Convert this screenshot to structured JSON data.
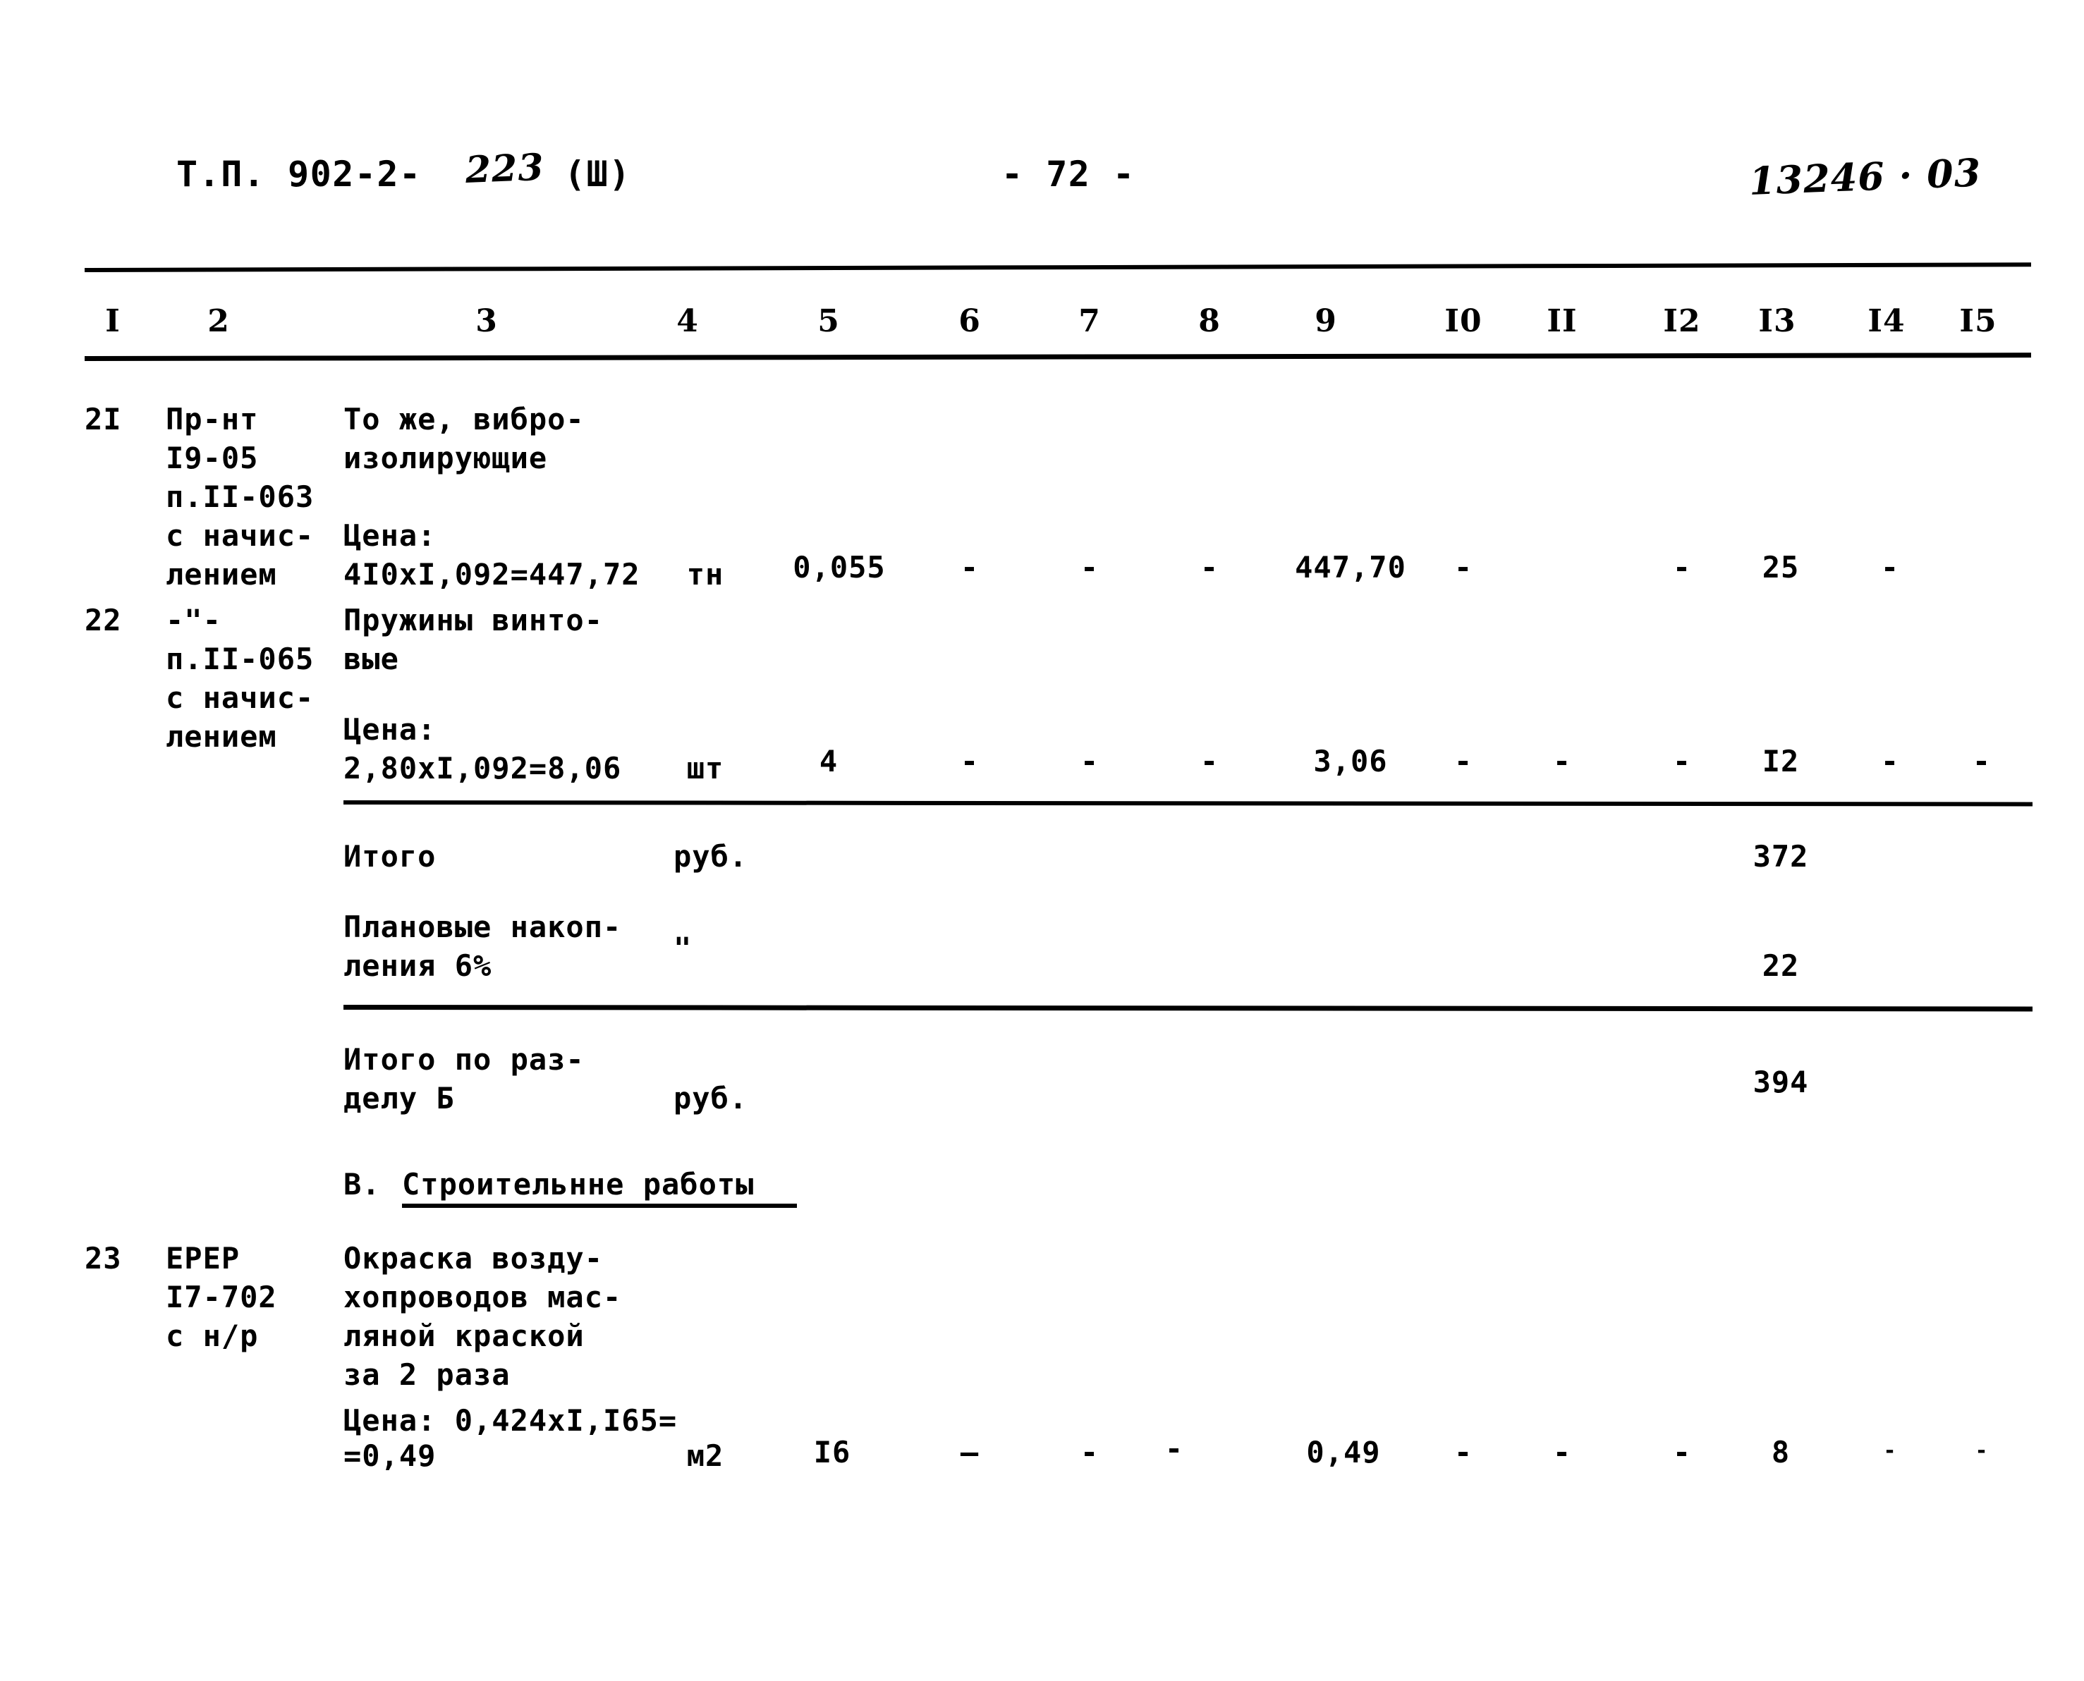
{
  "header": {
    "document_code": "Т.П. 902-2-",
    "document_code_hand": "223",
    "document_volume": "(Ш)",
    "page_number": "- 72 -",
    "archive_stamp": "13246 · 03"
  },
  "table": {
    "column_headers": [
      "I",
      "2",
      "3",
      "4",
      "5",
      "6",
      "7",
      "8",
      "9",
      "I0",
      "II",
      "I2",
      "I3",
      "I4",
      "I5"
    ],
    "rows": [
      {
        "num": "2I",
        "code_lines": [
          "Пр-нт",
          "I9-05",
          "п.II-063",
          "с начис-",
          "лением"
        ],
        "desc_lines": [
          "То же, вибро-",
          "изолирующие"
        ],
        "price_label": "Цена:",
        "price_calc": "4I0xI,092=447,72",
        "unit": "тн",
        "c5": "0,055",
        "c6": "-",
        "c7": "-",
        "c8": "-",
        "c9": "447,70",
        "c10": "-",
        "c11": "",
        "c12": "-",
        "c13": "25",
        "c14": "-",
        "c15": ""
      },
      {
        "num": "22",
        "code_lines": [
          "-\"-",
          "п.II-065",
          "с начис-",
          "лением"
        ],
        "desc_lines": [
          "Пружины винто-",
          "вые"
        ],
        "price_label": "Цена:",
        "price_calc": "2,80xI,092=8,06",
        "unit": "шт",
        "c5": "4",
        "c6": "-",
        "c7": "-",
        "c8": "-",
        "c9": "3,06",
        "c10": "-",
        "c11": "-",
        "c12": "-",
        "c13": "I2",
        "c14": "-",
        "c15": "-"
      }
    ],
    "totals": [
      {
        "label_lines": [
          "Итого"
        ],
        "unit": "руб.",
        "value": "372"
      },
      {
        "label_lines": [
          "Плановые накоп-",
          "ления 6%"
        ],
        "unit": "\"",
        "value": "22"
      },
      {
        "label_lines": [
          "Итого по раз-",
          "делу Б"
        ],
        "unit": "руб.",
        "value": "394"
      }
    ],
    "section_heading": {
      "prefix": "В.",
      "title": "Строительнне работы"
    },
    "rows_after_heading": [
      {
        "num": "23",
        "code_lines": [
          "ЕРЕР",
          "I7-702",
          "с н/р"
        ],
        "desc_lines": [
          "Окраска возду-",
          "хопроводов мас-",
          "ляной краской",
          "за 2 раза"
        ],
        "price_line1": "Цена: 0,424xI,I65=",
        "price_line2": "=0,49",
        "unit": "м2",
        "c5": "I6",
        "c6": "—",
        "c7": "-",
        "c8": "-",
        "c9": "0,49",
        "c10": "-",
        "c11": "-",
        "c12": "-",
        "c13": "8",
        "c14": "-",
        "c15": "-"
      }
    ]
  }
}
